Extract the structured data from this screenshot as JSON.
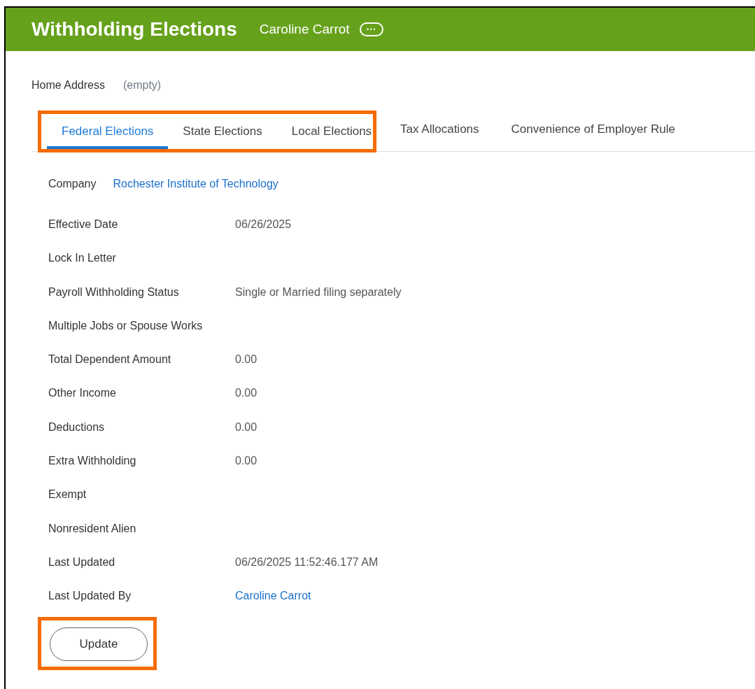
{
  "header": {
    "title": "Withholding Elections",
    "worker": "Caroline Carrot",
    "menu_icon": "···"
  },
  "home_address": {
    "label": "Home Address",
    "value": "(empty)"
  },
  "tabs": [
    {
      "label": "Federal Elections",
      "selected": true,
      "highlighted": true
    },
    {
      "label": "State Elections",
      "selected": false,
      "highlighted": true
    },
    {
      "label": "Local Elections",
      "selected": false,
      "highlighted": true
    },
    {
      "label": "Tax Allocations",
      "selected": false,
      "highlighted": false
    },
    {
      "label": "Convenience of Employer Rule",
      "selected": false,
      "highlighted": false
    }
  ],
  "company": {
    "label": "Company",
    "value": "Rochester Institute of Technology",
    "kind": "link"
  },
  "fields": [
    {
      "label": "Effective Date",
      "value": "06/26/2025",
      "kind": "text"
    },
    {
      "label": "Lock In Letter"
    },
    {
      "label": "Payroll Withholding Status",
      "value": "Single or Married filing separately",
      "kind": "text"
    },
    {
      "label": "Multiple Jobs or Spouse Works"
    },
    {
      "label": "Total Dependent Amount",
      "value": "0.00",
      "kind": "text"
    },
    {
      "label": "Other Income",
      "value": "0.00",
      "kind": "text"
    },
    {
      "label": "Deductions",
      "value": "0.00",
      "kind": "text"
    },
    {
      "label": "Extra Withholding",
      "value": "0.00",
      "kind": "text"
    },
    {
      "label": "Exempt"
    },
    {
      "label": "Nonresident Alien"
    },
    {
      "label": "Last Updated",
      "value": "06/26/2025 11:52:46.177 AM",
      "kind": "text"
    },
    {
      "label": "Last Updated By",
      "value": "Caroline Carrot",
      "kind": "link"
    }
  ],
  "update_button": {
    "label": "Update",
    "highlighted": true
  }
}
